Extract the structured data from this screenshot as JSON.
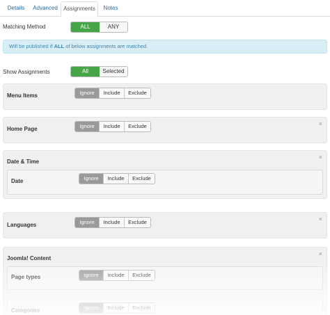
{
  "tabs": [
    {
      "label": "Details"
    },
    {
      "label": "Advanced"
    },
    {
      "label": "Assignments"
    },
    {
      "label": "Notes"
    }
  ],
  "matching_method": {
    "label": "Matching Method",
    "options": [
      "ALL",
      "ANY"
    ],
    "selected": "ALL"
  },
  "notice": {
    "prefix": "Will be published if ",
    "bold": "ALL",
    "suffix": " of below assignments are matched."
  },
  "show_assignments": {
    "label": "Show Assignments",
    "options": [
      "All",
      "Selected"
    ],
    "selected": "All"
  },
  "assignment_options": [
    "Ignore",
    "Include",
    "Exclude"
  ],
  "panels": {
    "menu_items": {
      "title": "Menu Items",
      "selected": "Ignore"
    },
    "home_page": {
      "title": "Home Page",
      "selected": "Ignore",
      "close": "×"
    },
    "date_time": {
      "title": "Date & Time",
      "close": "×",
      "sub": {
        "title": "Date",
        "selected": "Ignore"
      }
    },
    "languages": {
      "title": "Languages",
      "selected": "Ignore",
      "close": "×"
    },
    "joomla_content": {
      "title": "Joomla! Content",
      "close": "×",
      "subs": [
        {
          "title": "Page types",
          "selected": "Ignore"
        },
        {
          "title": "Categories",
          "selected": "Ignore"
        }
      ]
    }
  }
}
